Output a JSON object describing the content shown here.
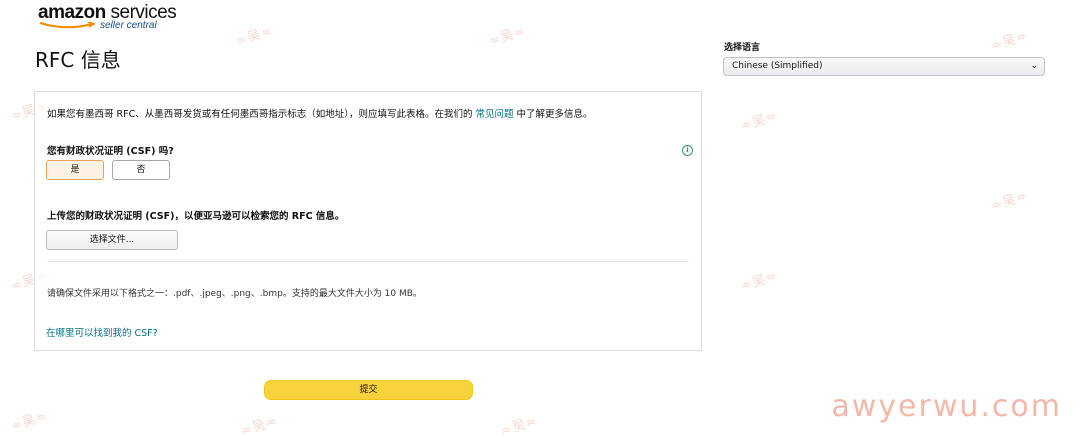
{
  "brand": {
    "name_bold": "amazon",
    "name_light": " services",
    "subtitle": "seller central"
  },
  "page": {
    "title": "RFC 信息"
  },
  "language": {
    "label": "选择语言",
    "selected": "Chinese (Simplified)"
  },
  "form": {
    "intro_prefix": "如果您有墨西哥 RFC、从墨西哥发货或有任何墨西哥指示标志（如地址），则应填写此表格。在我们的 ",
    "intro_link": "常见问题",
    "intro_suffix": " 中了解更多信息。",
    "csf_question": "您有财政状况证明 (CSF) 吗?",
    "yes_label": "是",
    "no_label": "否",
    "upload_label": "上传您的财政状况证明 (CSF)，以便亚马逊可以检索您的 RFC 信息。",
    "choose_file_label": "选择文件...",
    "format_note": "请确保文件采用以下格式之一：.pdf、.jpeg、.png、.bmp。支持的最大文件大小为 10 MB。",
    "csf_help_link": "在哪里可以找到我的 CSF?",
    "submit_label": "提交"
  },
  "watermark": {
    "text": "awyerwu.com"
  },
  "icons": {
    "info": "info-circle-icon",
    "dropdown": "chevron-down-icon"
  },
  "colors": {
    "link": "#007185",
    "submit": "#f7d23c",
    "selected_border": "#e4a45a"
  }
}
